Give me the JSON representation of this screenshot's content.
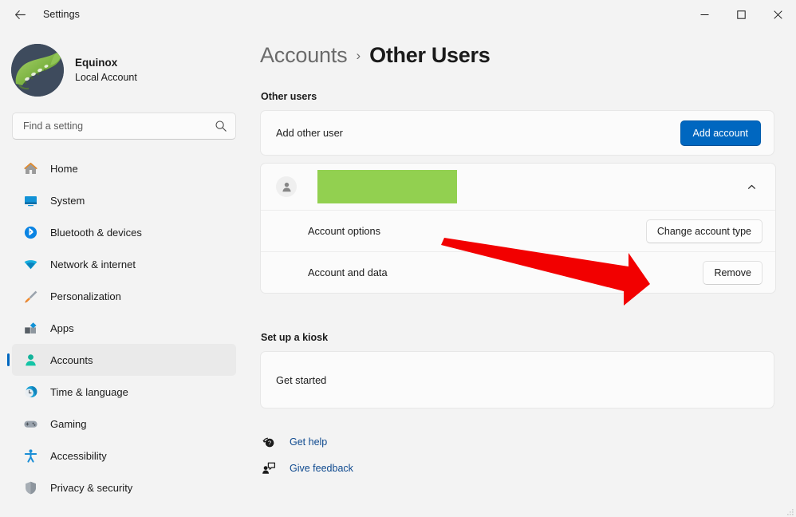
{
  "window": {
    "title": "Settings",
    "back_icon": "back-arrow-icon",
    "controls": {
      "minimize": "minimize-icon",
      "maximize": "maximize-icon",
      "close": "close-icon"
    }
  },
  "sidebar": {
    "profile": {
      "name": "Equinox",
      "subtitle": "Local Account",
      "avatar_icon": "caterpillar-avatar"
    },
    "search": {
      "placeholder": "Find a setting",
      "value": "",
      "icon": "search-icon"
    },
    "items": [
      {
        "label": "Home",
        "icon": "home-icon",
        "active": false
      },
      {
        "label": "System",
        "icon": "system-icon",
        "active": false
      },
      {
        "label": "Bluetooth & devices",
        "icon": "bluetooth-icon",
        "active": false
      },
      {
        "label": "Network & internet",
        "icon": "network-icon",
        "active": false
      },
      {
        "label": "Personalization",
        "icon": "paintbrush-icon",
        "active": false
      },
      {
        "label": "Apps",
        "icon": "apps-icon",
        "active": false
      },
      {
        "label": "Accounts",
        "icon": "accounts-icon",
        "active": true
      },
      {
        "label": "Time & language",
        "icon": "clock-icon",
        "active": false
      },
      {
        "label": "Gaming",
        "icon": "gamepad-icon",
        "active": false
      },
      {
        "label": "Accessibility",
        "icon": "accessibility-icon",
        "active": false
      },
      {
        "label": "Privacy & security",
        "icon": "shield-icon",
        "active": false
      }
    ]
  },
  "main": {
    "breadcrumb": {
      "parent": "Accounts",
      "separator": "›",
      "current": "Other Users"
    },
    "other_users": {
      "section_label": "Other users",
      "add_user": {
        "label": "Add other user",
        "button": "Add account"
      },
      "account": {
        "name_redacted": "",
        "avatar_icon": "person-icon",
        "expand_icon": "chevron-up-icon",
        "rows": [
          {
            "label": "Account options",
            "button": "Change account type"
          },
          {
            "label": "Account and data",
            "button": "Remove"
          }
        ]
      }
    },
    "kiosk": {
      "section_label": "Set up a kiosk",
      "button": "Get started"
    },
    "links": [
      {
        "label": "Get help",
        "icon": "help-icon"
      },
      {
        "label": "Give feedback",
        "icon": "feedback-icon"
      }
    ]
  },
  "annotation": {
    "type": "arrow",
    "color": "#f20000",
    "points_to": "Remove"
  },
  "colors": {
    "accent": "#0067c0",
    "page_bg": "#f3f3f3",
    "card_bg": "#fbfbfb",
    "redaction": "#92d050",
    "link": "#0f4a8f",
    "annotation_red": "#f20000"
  }
}
